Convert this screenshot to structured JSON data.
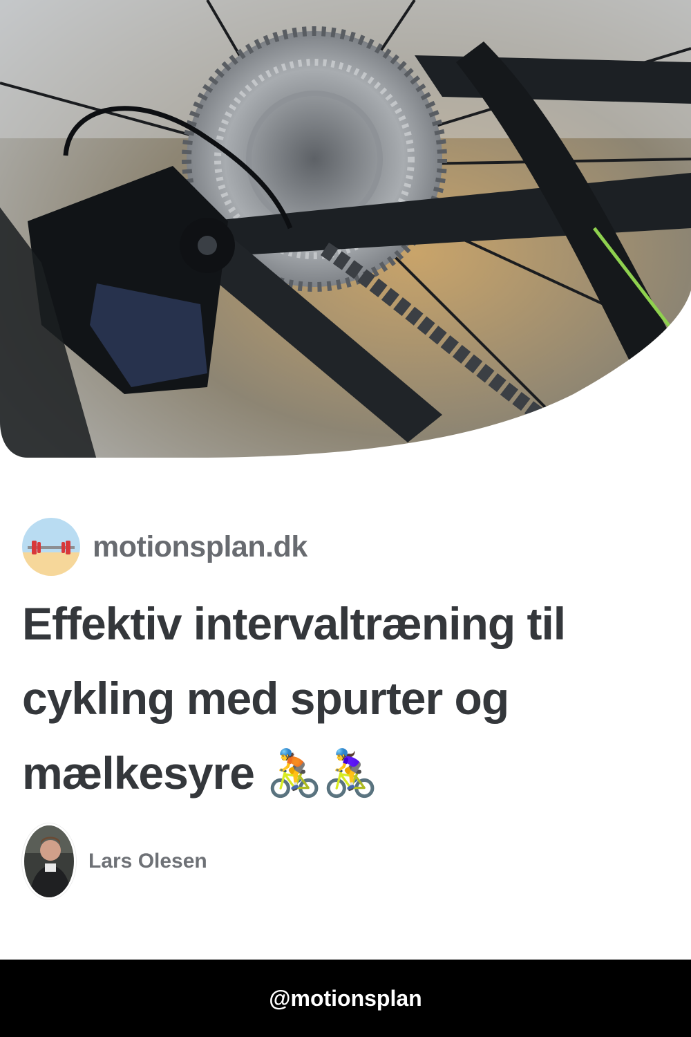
{
  "hero": {
    "image_description_icon": "bicycle-rear-derailleur-photo"
  },
  "brand": {
    "name": "motionsplan.dk",
    "avatar_icon": "barbell-icon"
  },
  "article": {
    "title": "Effektiv intervaltræning til cykling med spurter og mælkesyre 🚴🚴‍♀️"
  },
  "author": {
    "name": "Lars Olesen",
    "avatar_icon": "author-photo"
  },
  "footer": {
    "handle": "@motionsplan"
  },
  "colors": {
    "footer_bg": "#000000",
    "title": "#34373b",
    "brand": "#686b70"
  }
}
